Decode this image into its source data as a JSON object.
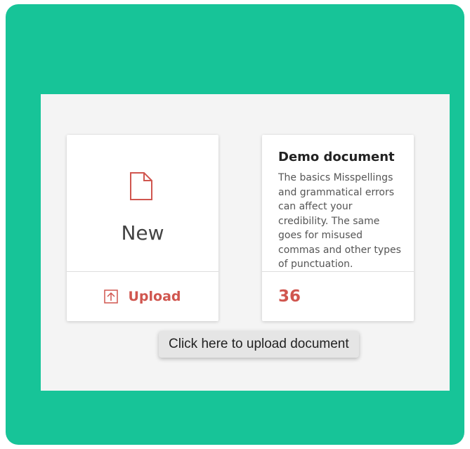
{
  "new_card": {
    "title": "New",
    "icon": "file-icon",
    "upload_label": "Upload",
    "upload_icon": "upload-icon"
  },
  "doc_card": {
    "title": "Demo document",
    "body": "The basics Misspellings and grammatical errors can affect your credibility. The same goes for misused commas and other types of punctuation.",
    "count": "36"
  },
  "tooltip": {
    "text": "Click here to upload document"
  },
  "colors": {
    "background": "#17c498",
    "panel": "#f4f4f4",
    "accent": "#d0564f"
  }
}
